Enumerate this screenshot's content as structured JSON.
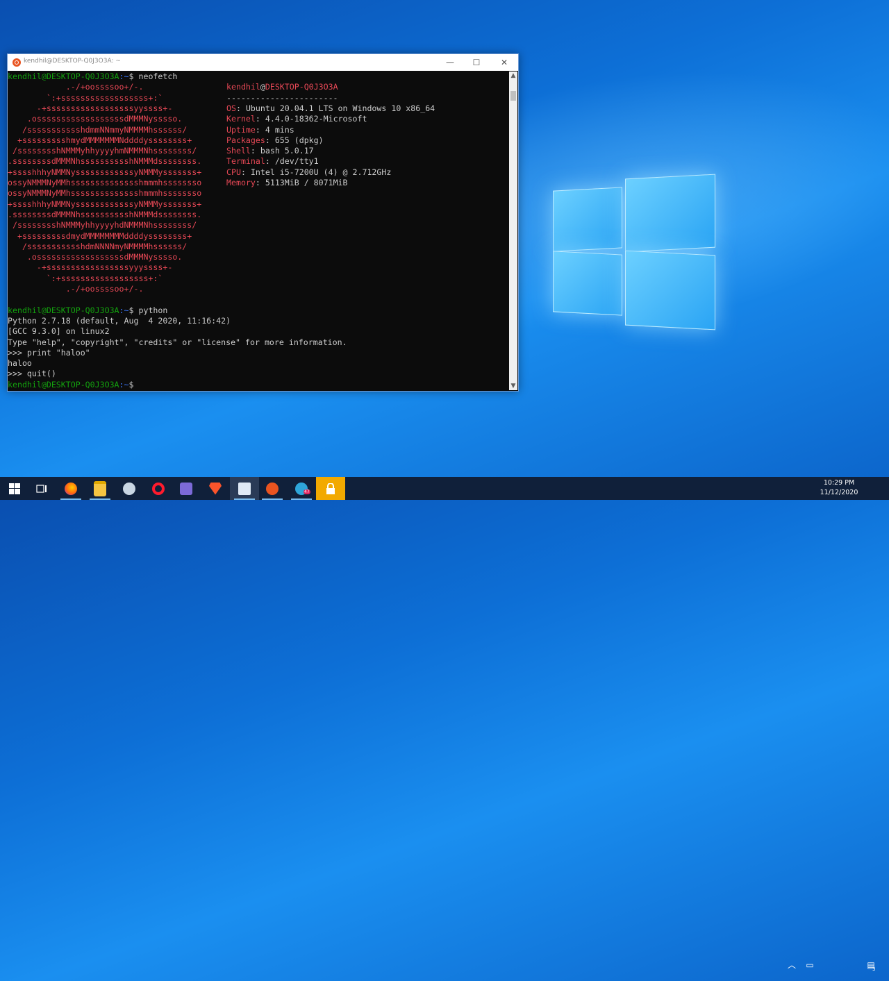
{
  "window": {
    "title": "kendhil@DESKTOP-Q0J3O3A: ~",
    "minimize": "—",
    "maximize": "☐",
    "close": "✕"
  },
  "terminal": {
    "prompt_user": "kendhil@DESKTOP-Q0J3O3A",
    "prompt_path": ":~",
    "prompt_sign": "$ ",
    "cmd1": "neofetch",
    "logo": [
      "            .-/+oossssoo+/-.",
      "        `:+ssssssssssssssssss+:`",
      "      -+ssssssssssssssssssyyssss+-",
      "    .ossssssssssssssssssdMMMNysssso.",
      "   /ssssssssssshdmmNNmmyNMMMMhssssss/",
      "  +ssssssssshmydMMMMMMMNddddyssssssss+",
      " /sssssssshNMMMyhhyyyyhmNMMMNhssssssss/",
      ".ssssssssdMMMNhsssssssssshNMMMdssssssss.",
      "+sssshhhyNMMNyssssssssssssyNMMMysssssss+",
      "ossyNMMMNyMMhsssssssssssssshmmmhssssssso",
      "ossyNMMMNyMMhsssssssssssssshmmmhssssssso",
      "+sssshhhyNMMNyssssssssssssyNMMMysssssss+",
      ".ssssssssdMMMNhsssssssssshNMMMdssssssss.",
      " /sssssssshNMMMyhhyyyyhdNMMMNhssssssss/",
      "  +sssssssssdmydMMMMMMMMddddyssssssss+",
      "   /ssssssssssshdmNNNNmyNMMMMhssssss/",
      "    .ossssssssssssssssssdMMMNysssso.",
      "      -+sssssssssssssssssyyyssss+-",
      "        `:+ssssssssssssssssss+:`",
      "            .-/+oossssoo+/-."
    ],
    "info_user": "kendhil",
    "info_at": "@",
    "info_host": "DESKTOP-Q0J3O3A",
    "info_sep": "-----------------------",
    "info": [
      {
        "key": "OS",
        "value": "Ubuntu 20.04.1 LTS on Windows 10 x86_64"
      },
      {
        "key": "Kernel",
        "value": "4.4.0-18362-Microsoft"
      },
      {
        "key": "Uptime",
        "value": "4 mins"
      },
      {
        "key": "Packages",
        "value": "655 (dpkg)"
      },
      {
        "key": "Shell",
        "value": "bash 5.0.17"
      },
      {
        "key": "Terminal",
        "value": "/dev/tty1"
      },
      {
        "key": "CPU",
        "value": "Intel i5-7200U (4) @ 2.712GHz"
      },
      {
        "key": "Memory",
        "value": "5113MiB / 8071MiB"
      }
    ],
    "cmd2": "python",
    "py_lines": [
      "Python 2.7.18 (default, Aug  4 2020, 11:16:42)",
      "[GCC 9.3.0] on linux2",
      "Type \"help\", \"copyright\", \"credits\" or \"license\" for more information.",
      ">>> print \"haloo\"",
      "haloo",
      ">>> quit()"
    ]
  },
  "taskbar": {
    "time": "10:29 PM",
    "date": "11/12/2020",
    "notification_count": "3",
    "telegram_badge": "47",
    "icons": [
      "windows-start-icon",
      "task-view-icon",
      "firefox-icon",
      "file-explorer-icon",
      "app-icon",
      "opera-icon",
      "network-app-icon",
      "brave-icon",
      "notepad-icon",
      "ubuntu-icon",
      "telegram-icon",
      "lock-app-icon"
    ]
  }
}
